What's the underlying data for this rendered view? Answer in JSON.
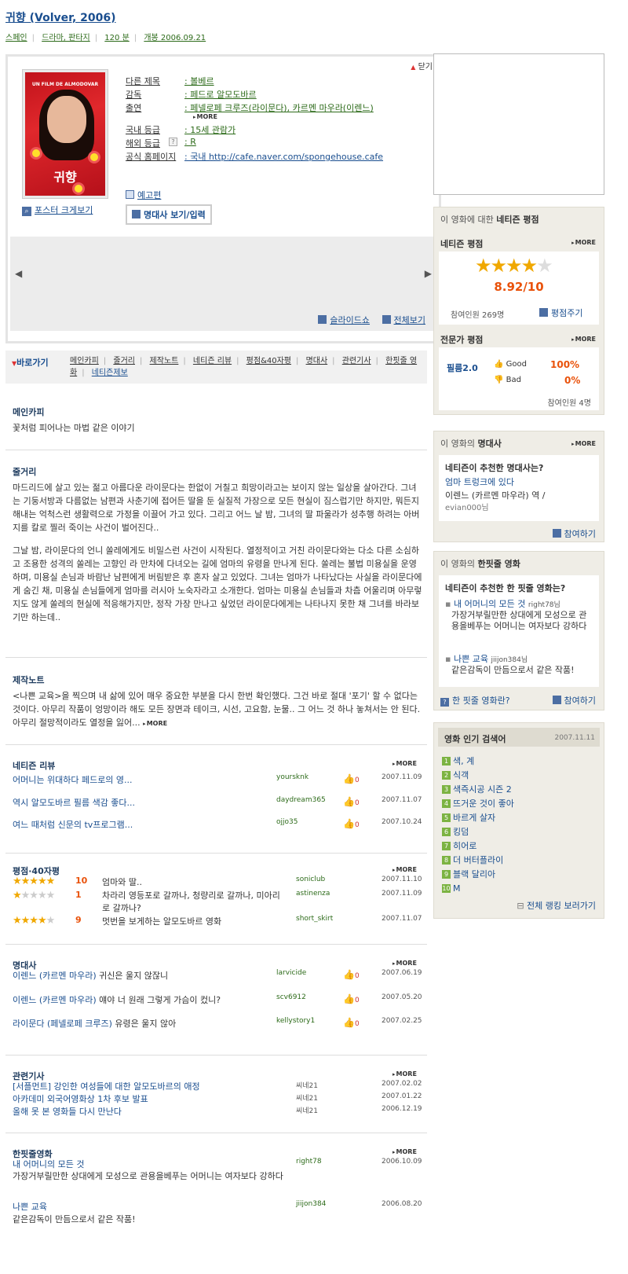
{
  "header": {
    "title": "귀향 (Volver, 2006)",
    "meta": [
      "스페인",
      "드라마, 판타지",
      "120 분",
      "개봉 2006.09.21"
    ]
  },
  "info": {
    "close_label": "닫기",
    "poster_title": "UN FILM DE ALMODOVAR",
    "poster_name": "귀향",
    "poster_zoom": "포스터 크게보기",
    "rows": [
      {
        "k": "다른 제목",
        "v": ": 볼베르"
      },
      {
        "k": "감독",
        "v": ": 페드로 알모도바르"
      },
      {
        "k": "출연",
        "v": ": 페넬로페 크루즈(라이문다), 카르멘 마우라(이렌느)"
      },
      {
        "k": "국내 등급",
        "v": ": 15세 관람가"
      },
      {
        "k": "해외 등급",
        "v": ": R"
      },
      {
        "k": "공식 홈페이지",
        "v": ": 국내 http://cafe.naver.com/spongehouse.cafe"
      }
    ],
    "cast_more": "MORE",
    "trailer": "예고편",
    "quote_btn": "명대사 보기/입력",
    "slideshow": "슬라이드쇼",
    "view_all": "전체보기"
  },
  "nav": {
    "goto": "바로가기",
    "links": [
      "메인카피",
      "줄거리",
      "제작노트",
      "네티즌 리뷰",
      "평점&40자평",
      "명대사",
      "관련기사",
      "한핏줄 영화",
      "네티즌제보"
    ]
  },
  "main_copy": {
    "title": "메인카피",
    "text": "꽃처럼 피어나는 마법 같은 이야기"
  },
  "synopsis": {
    "title": "줄거리",
    "p1": "  마드리드에 살고 있는 젊고 아름다운 라이문다는 한없이 거칠고 희망이라고는 보이지 않는 일상을 살아간다. 그녀는 기둥서방과 다름없는 남편과 사춘기에 접어든 딸을 둔 실질적 가장으로 모든 현실이 짐스럽기만 하지만, 뭐든지 해내는 억척스런 생활력으로 가정을 이끌어 가고 있다. 그리고 어느 날 밤, 그녀의 딸 파울라가 성추행 하려는 아버지를 칼로 찔러 죽이는 사건이 벌어진다..",
    "p2": "  그날 밤, 라이문다의 언니 쏠레에게도 비밀스런 사건이 시작된다. 열정적이고 거친 라이문다와는 다소 다른 소심하고 조용한 성격의 쏠레는 고향인 라 만차에 다녀오는 길에 엄마의 유령을 만나게 된다. 쏠레는 불법 미용실을 운영하며, 미용실 손님과 바람난 남편에게 버림받은 후 혼자 살고 있었다. 그녀는 엄마가 나타났다는 사실을 라이문다에게 숨긴 채, 미용실 손님들에게 엄마를 러시아 노숙자라고 소개한다. 엄마는 미용실 손님들과 차츰 어울리며 아무렇지도 않게 쏠레의 현실에 적응해가지만, 정작 가장 만나고 싶었던 라이문다에게는 나타나지 못한 채 그녀를 바라보기만 하는데.."
  },
  "production": {
    "title": "제작노트",
    "text": "<나쁜 교육>을 찍으며 내 삶에 있어 매우 중요한 부분을 다시 한번 확인했다. 그건 바로 절대 '포기' 할 수 없다는 것이다. 아무리 작품이 엉망이라 해도 모든 장면과 테이크, 시선, 고요함, 눈물.. 그 어느 것 하나 놓쳐서는 안 된다. 아무리 절망적이라도 열정을 잃어...",
    "more": "MORE"
  },
  "reviews": {
    "title": "네티즌 리뷰",
    "more": "MORE",
    "items": [
      {
        "t": "어머니는 위대하다 페드로의 영...",
        "u": "yoursknk",
        "n": "0",
        "d": "2007.11.09"
      },
      {
        "t": "역시 알모도바르 필름 색감 좋다...",
        "u": "daydream365",
        "n": "0",
        "d": "2007.11.07"
      },
      {
        "t": "여느 때처럼 신문의 tv프로그램...",
        "u": "ojjo35",
        "n": "0",
        "d": "2007.10.24"
      }
    ]
  },
  "ratings": {
    "title": "평점·40자평",
    "more": "MORE",
    "items": [
      {
        "stars": 5,
        "score": "10",
        "t": "엄마와 딸..",
        "u": "soniclub",
        "d": "2007.11.10"
      },
      {
        "stars": 0.5,
        "score": "1",
        "t": "차라리 영등포로 갈까나, 청량리로 갈까나, 미아리로 갈까나?",
        "u": "astinenza",
        "d": "2007.11.09"
      },
      {
        "stars": 4.5,
        "score": "9",
        "t": "멋번을 보게하는 알모도바르 영화",
        "u": "short_skirt",
        "d": "2007.11.07"
      }
    ]
  },
  "quotes": {
    "title": "명대사",
    "more": "MORE",
    "items": [
      {
        "who": "이렌느 (카르멘 마우라)",
        "t": "귀신은 울지 않잖니",
        "u": "larvicide",
        "n": "0",
        "d": "2007.06.19"
      },
      {
        "who": "이렌느 (카르멘 마우라)",
        "t": "얘야 너 원래 그렇게 가슴이 컸니?",
        "u": "scv6912",
        "n": "0",
        "d": "2007.05.20"
      },
      {
        "who": "라이문다 (페넬로페 크루즈)",
        "t": "유령은 울지 않아",
        "u": "kellystory1",
        "n": "0",
        "d": "2007.02.25"
      }
    ]
  },
  "articles": {
    "title": "관련기사",
    "more": "MORE",
    "items": [
      {
        "t": "[서플먼트] 강인한 여성들에 대한 알모도바르의 애정",
        "s": "씨네21",
        "d": "2007.02.02"
      },
      {
        "t": "아카데미 외국어영화상 1차 후보 발표",
        "s": "씨네21",
        "d": "2007.01.22"
      },
      {
        "t": "올해 못 본 영화들 다시 만난다",
        "s": "씨네21",
        "d": "2006.12.19"
      }
    ]
  },
  "related": {
    "title": "한핏줄영화",
    "more": "MORE",
    "items": [
      {
        "t": "내 어머니의 모든 것",
        "desc": "가장거부릴만한 상대에게 모성으로 관용을베푸는 어머니는 여자보다 강하다",
        "u": "right78",
        "d": "2006.10.09"
      },
      {
        "t": "나쁜 교육",
        "desc": "같은감독이 만듬으로서 같은 작품!",
        "u": "jiijon384",
        "d": "2006.08.20"
      }
    ]
  },
  "netizen_score": {
    "header_pre": "이 영화에 대한 ",
    "header_bold": "네티즌 평점",
    "sub1": "네티즌 평점",
    "more": "MORE",
    "score": "8.92/10",
    "stars": 4.5,
    "participants": "참여인원 269명",
    "rate_btn": "평점주기",
    "sub2": "전문가 평점",
    "expert_name": "필름2.0",
    "good_label": "Good",
    "good_pct": "100%",
    "bad_label": "Bad",
    "bad_pct": "0%",
    "expert_participants": "참여인원 4명"
  },
  "best_quote": {
    "header_pre": "이 영화의 ",
    "header_bold": "명대사",
    "more": "MORE",
    "q_title": "네티즌이 추천한 명대사는?",
    "quote": "엄마 트렁크에 있다",
    "who": "이렌느 (카르멘 마우라) 역 /",
    "user": "evian000님",
    "join": "참여하기"
  },
  "best_related": {
    "header_pre": "이 영화의 ",
    "header_bold": "한핏줄 영화",
    "q_title": "네티즌이 추천한 한 핏줄 영화는?",
    "items": [
      {
        "t": "내 어머니의 모든 것",
        "u": "right78님",
        "desc": "가장거부릴만한 상대에게 모성으로 관용을베푸는 어머니는 여자보다 강하다"
      },
      {
        "t": "나쁜 교육",
        "u": "jiijon384님",
        "desc": "같은감독이 만듬으로서 같은 작품!"
      }
    ],
    "what": "한 핏줄 영화란?",
    "join": "참여하기"
  },
  "popular": {
    "title": "영화 인기 검색어",
    "date": "2007.11.11",
    "items": [
      "색, 계",
      "식객",
      "색즉시공 시즌 2",
      "뜨거운 것이 좋아",
      "바르게 살자",
      "킹덤",
      "히어로",
      "더 버터플라이",
      "블랙 달리아",
      "M"
    ],
    "all_link": "전체 랭킹 보러가기"
  },
  "colors": {
    "link": "#1a4e8f",
    "green": "#2d6b1a",
    "star": "#f0a800",
    "accent": "#e9520b"
  }
}
